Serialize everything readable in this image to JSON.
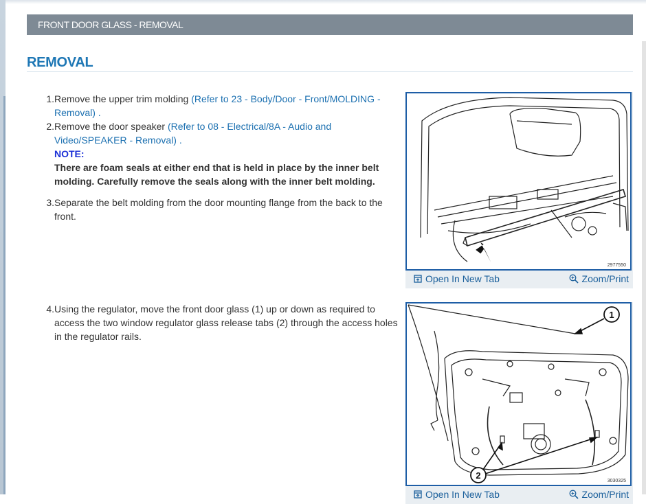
{
  "section_title": "FRONT DOOR GLASS - REMOVAL",
  "heading": "REMOVAL",
  "steps": [
    {
      "num": "1",
      "text": "Remove the upper trim molding ",
      "link": "(Refer to 23 - Body/Door - Front/MOLDING - Removal)",
      "suffix": " ."
    },
    {
      "num": "2",
      "text": "Remove the door speaker ",
      "link": "(Refer to 08 - Electrical/8A - Audio and Video/SPEAKER - Removal)",
      "suffix": " .",
      "note_label": "NOTE:",
      "note_text": "There are foam seals at either end that is held in place by the inner belt molding. Carefully remove the seals along with the inner belt molding."
    },
    {
      "num": "3",
      "text": "Separate the belt molding from the door mounting flange from the back to the front."
    },
    {
      "num": "4",
      "text": "Using the regulator, move the front door glass (1) up or down as required to access the two window regulator glass release tabs (2) through the access holes in the regulator rails."
    }
  ],
  "figures": [
    {
      "figure_number": "2977550",
      "open_label": "Open In New Tab",
      "zoom_label": "Zoom/Print"
    },
    {
      "figure_number": "3030325",
      "callout_1": "1",
      "callout_2": "2",
      "open_label": "Open In New Tab",
      "zoom_label": "Zoom/Print"
    }
  ],
  "icons": {
    "open": "open-in-new-tab-icon",
    "zoom": "zoom-icon"
  },
  "colors": {
    "section_bar": "#7e8a95",
    "heading": "#1e77b5",
    "link": "#1a6fb0",
    "note_label": "#1a2fd6",
    "figure_border": "#1e5ea6"
  }
}
